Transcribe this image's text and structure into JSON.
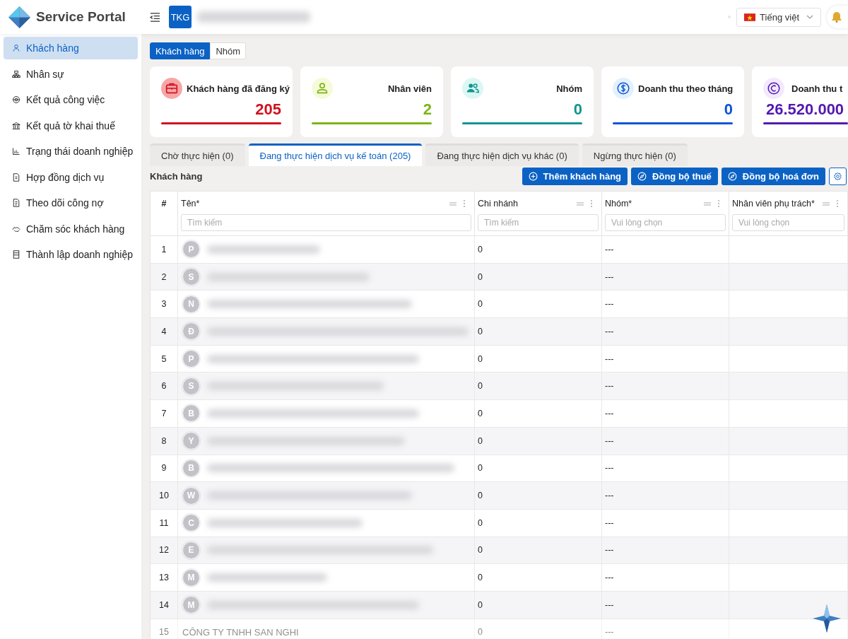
{
  "sidebar": {
    "logo_text": "Service Portal",
    "items": [
      {
        "label": "Khách hàng",
        "selected": true
      },
      {
        "label": "Nhân sự",
        "selected": false
      },
      {
        "label": "Kết quả công việc",
        "selected": false
      },
      {
        "label": "Kết quả tờ khai thuế",
        "selected": false
      },
      {
        "label": "Trạng thái doanh nghiệp",
        "selected": false
      },
      {
        "label": "Hợp đồng dịch vụ",
        "selected": false
      },
      {
        "label": "Theo dõi công nợ",
        "selected": false
      },
      {
        "label": "Chăm sóc khách hàng",
        "selected": false
      },
      {
        "label": "Thành lập doanh nghiệp",
        "selected": false
      }
    ]
  },
  "header": {
    "badge": "TKG",
    "language": "Tiếng việt"
  },
  "view_switch": [
    {
      "label": "Khách hàng",
      "selected": true
    },
    {
      "label": "Nhóm",
      "selected": false
    }
  ],
  "stats": [
    {
      "title": "Khách hàng đã đăng ký",
      "value": "205",
      "color": "#d0121f"
    },
    {
      "title": "Nhân viên",
      "value": "2",
      "color": "#7cb518"
    },
    {
      "title": "Nhóm",
      "value": "0",
      "color": "#0f9690"
    },
    {
      "title": "Doanh thu theo tháng",
      "value": "0",
      "color": "#0b55d6"
    },
    {
      "title": "Doanh thu t",
      "value": "26.520.000",
      "color": "#5319b0"
    }
  ],
  "status_tabs": [
    {
      "label": "Chờ thực hiện (0)",
      "selected": false
    },
    {
      "label": "Đang thực hiện dịch vụ kế toán (205)",
      "selected": true
    },
    {
      "label": "Đang thực hiện dịch vụ khác (0)",
      "selected": false
    },
    {
      "label": "Ngừng thực hiện (0)",
      "selected": false
    }
  ],
  "section_title": "Khách hàng",
  "actions": [
    {
      "label": "Thêm khách hàng",
      "kind": "add"
    },
    {
      "label": "Đồng bộ thuế",
      "kind": "sync"
    },
    {
      "label": "Đồng bộ hoá đơn",
      "kind": "sync"
    },
    {
      "kind": "settings"
    }
  ],
  "table": {
    "columns": [
      {
        "label": "#"
      },
      {
        "label": "Tên*",
        "placeholder": "Tìm kiếm"
      },
      {
        "label": "Chi nhánh",
        "placeholder": "Tìm kiếm"
      },
      {
        "label": "Nhóm*",
        "placeholder": "Vui lòng chọn"
      },
      {
        "label": "Nhân viên phụ trách*",
        "placeholder": "Vui lòng chọn"
      }
    ],
    "rows": [
      {
        "index": "1",
        "initial": "P",
        "branch": "0",
        "group": "---",
        "faded": false
      },
      {
        "index": "2",
        "initial": "S",
        "branch": "0",
        "group": "---",
        "faded": false
      },
      {
        "index": "3",
        "initial": "N",
        "branch": "0",
        "group": "---",
        "faded": false
      },
      {
        "index": "4",
        "initial": "Đ",
        "branch": "0",
        "group": "---",
        "faded": false
      },
      {
        "index": "5",
        "initial": "P",
        "branch": "0",
        "group": "---",
        "faded": false
      },
      {
        "index": "6",
        "initial": "S",
        "branch": "0",
        "group": "---",
        "faded": false
      },
      {
        "index": "7",
        "initial": "B",
        "branch": "0",
        "group": "---",
        "faded": false
      },
      {
        "index": "8",
        "initial": "Y",
        "branch": "0",
        "group": "---",
        "faded": false
      },
      {
        "index": "9",
        "initial": "B",
        "branch": "0",
        "group": "---",
        "faded": false
      },
      {
        "index": "10",
        "initial": "W",
        "branch": "0",
        "group": "---",
        "faded": false
      },
      {
        "index": "11",
        "initial": "C",
        "branch": "0",
        "group": "---",
        "faded": false
      },
      {
        "index": "12",
        "initial": "E",
        "branch": "0",
        "group": "---",
        "faded": false
      },
      {
        "index": "13",
        "initial": "M",
        "branch": "0",
        "group": "---",
        "faded": false
      },
      {
        "index": "14",
        "initial": "M",
        "branch": "0",
        "group": "---",
        "faded": false
      },
      {
        "index": "15",
        "name": "CÔNG TY TNHH SAN NGHI",
        "branch": "0",
        "group": "---",
        "faded": true
      }
    ]
  }
}
